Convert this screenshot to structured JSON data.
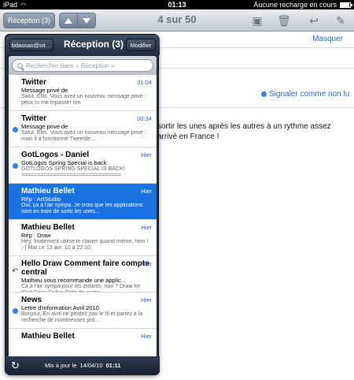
{
  "status_bar": {
    "device": "iPad",
    "time": "01:13",
    "battery_text": "Aucune recharge en cours"
  },
  "toolbar": {
    "inbox_button": "Réception (3)",
    "message_counter": "4 sur 50",
    "icons": [
      "move-to-folder-icon",
      "trash-icon",
      "reply-icon",
      "compose-icon"
    ]
  },
  "message_view": {
    "hide_link": "Masquer",
    "report_link": "Signaler comme non lu",
    "body_lines": [
      "sortir les unes après les autres à un rythme assez",
      "arrivé en France !"
    ],
    "stray_char": ":"
  },
  "popover": {
    "account_button": "bdassas@sit…",
    "title": "Réception (3)",
    "edit_button": "Modifier",
    "search_placeholder": "Rechercher dans « Réception »",
    "messages": [
      {
        "from": "Twitter",
        "date": "01:04",
        "subject": "Message privé de",
        "preview": "Salut, Ellis. Vous avez un nouveau message privé :                peux tu me repasser ton",
        "unread": false,
        "replied": false,
        "selected": false
      },
      {
        "from": "Twitter",
        "date": "00:34",
        "subject": "Message privé de",
        "preview": "Salut, Ellis. Vous avez un nouveau message privé :               mais il a fonctionné Tweetde...",
        "unread": true,
        "replied": false,
        "selected": false
      },
      {
        "from": "GotLogos - Daniel",
        "date": "Hier",
        "subject": "GotLogos          Spring Special is back",
        "preview": "GOTLOGOS SPRING SPECIAL IS BACK! ===============================",
        "unread": true,
        "replied": false,
        "selected": false
      },
      {
        "from": "Mathieu Bellet",
        "date": "Hier",
        "subject": "Rép : ArtStudio",
        "preview": "Oui, ça a l'air sympa. Je crois que les applications sont en train de sortir les unes...",
        "unread": false,
        "replied": false,
        "selected": true
      },
      {
        "from": "Mathieu Bellet",
        "date": "Hier",
        "subject": "Rép : Draw",
        "preview": "Hey, finalement utilise le clavier quand même, hein ! ;-) Mat Le 13 avr. 10 à 22:10,",
        "unread": false,
        "replied": false,
        "selected": false
      },
      {
        "from": "Hello Draw Comment faire compte central",
        "date": "Hier",
        "subject": "Mathieu vous recommande une applic...",
        "preview": "Ca a l'air sympa pour les enfants, non ? Draw for iPad Erica Sadun Date de sortie :",
        "unread": false,
        "replied": true,
        "selected": false
      },
      {
        "from": "News",
        "date": "Hier",
        "subject": "Lettre d'information          Avril 2010",
        "preview": "Bonjour, En avril ne perdez pas le fil et partez à la recherche de nombreuses pro...",
        "unread": true,
        "replied": false,
        "selected": false
      },
      {
        "from": "Mathieu Bellet",
        "date": "Hier",
        "subject": "",
        "preview": "",
        "unread": false,
        "replied": false,
        "selected": false
      }
    ],
    "footer": {
      "label": "Mis à jour le",
      "date": "14/04/10",
      "time": "01:11"
    }
  }
}
